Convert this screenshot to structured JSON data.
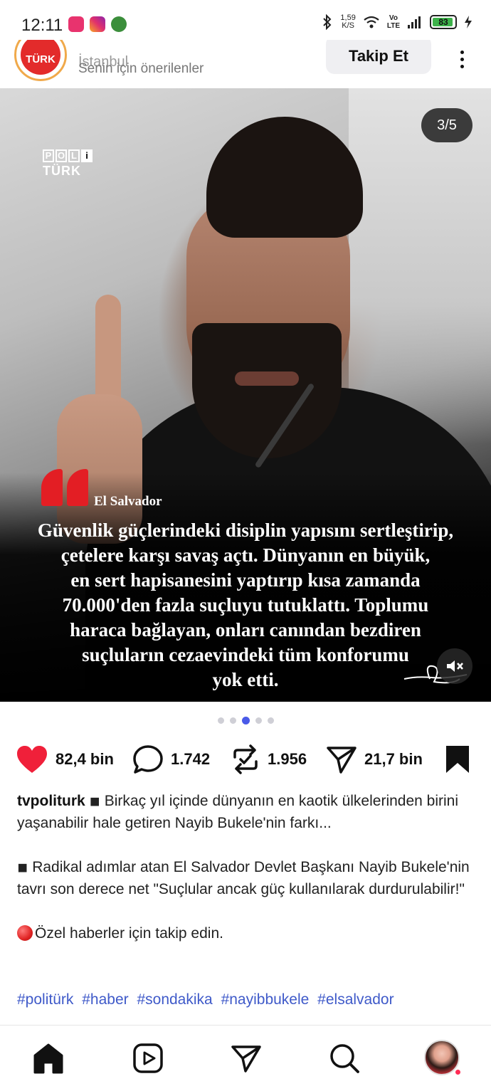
{
  "status_bar": {
    "time": "12:11",
    "net_speed_value": "1,59",
    "net_speed_unit": "K/S",
    "volte_top": "Vo",
    "volte_bottom": "LTE",
    "battery": "83"
  },
  "post_header": {
    "account_logo_text": "TÜRK",
    "location": "İstanbul",
    "subtitle": "Senin için önerilenler",
    "follow_label": "Takip Et"
  },
  "media": {
    "brand_letters": [
      "P",
      "O",
      "L",
      "i"
    ],
    "brand_bottom": "TÜRK",
    "counter": "3/5",
    "location_tag": "El Salvador",
    "quote": "Güvenlik güçlerindeki disiplin yapısını sertleştirip,\nçetelere karşı savaş açtı. Dünyanın en büyük,\nen sert hapisanesini yaptırıp kısa zamanda\n70.000'den fazla suçluyu tutuklattı. Toplumu\nharaca bağlayan, onları canından bezdiren\nsuçluların cezaevindeki tüm konforumu\nyok etti.",
    "carousel_total": 5,
    "carousel_active": 3
  },
  "actions": {
    "likes": "82,4 bin",
    "comments": "1.742",
    "reposts": "1.956",
    "shares": "21,7 bin"
  },
  "caption": {
    "username": "tvpoliturk",
    "para1": "◾ Birkaç yıl içinde dünyanın en kaotik ülkelerinden birini yaşanabilir hale getiren Nayib Bukele'nin farkı...",
    "para2": "◾ Radikal adımlar atan El Salvador Devlet Başkanı Nayib Bukele'nin tavrı son derece net \"Suçlular ancak güç kullanılarak durdurulabilir!\"",
    "para3": "Özel haberler için takip edin.",
    "hashtags": [
      "#politürk",
      "#haber",
      "#sondakika",
      "#nayibbukele",
      "#elsalvador"
    ]
  },
  "colors": {
    "like_red": "#f0203a",
    "accent_blue": "#4a5ae8",
    "hashtag_blue": "#3f5ac9",
    "quote_red": "#e31e24"
  },
  "icons": {
    "like": "heart-icon",
    "comment": "speech-bubble-icon",
    "repost": "repost-icon",
    "share": "paper-plane-icon",
    "save": "bookmark-icon",
    "nav": [
      "home-icon",
      "reels-icon",
      "paper-plane-icon",
      "search-icon",
      "profile-avatar"
    ]
  }
}
